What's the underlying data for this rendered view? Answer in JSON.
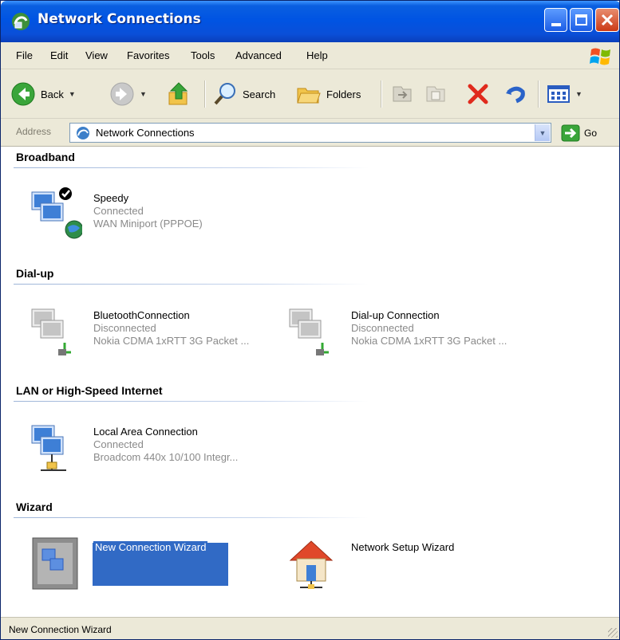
{
  "window": {
    "title": "Network Connections"
  },
  "menu": [
    "File",
    "Edit",
    "View",
    "Favorites",
    "Tools",
    "Advanced",
    "Help"
  ],
  "toolbar": {
    "back_label": "Back",
    "search_label": "Search",
    "folders_label": "Folders"
  },
  "address": {
    "label": "Address",
    "value": "Network Connections",
    "go_label": "Go"
  },
  "groups": {
    "broadband": {
      "title": "Broadband",
      "items": [
        {
          "name": "Speedy",
          "status": "Connected",
          "device": "WAN Miniport (PPPOE)"
        }
      ]
    },
    "dialup": {
      "title": "Dial-up",
      "items": [
        {
          "name": "BluetoothConnection",
          "status": "Disconnected",
          "device": "Nokia CDMA 1xRTT 3G Packet ..."
        },
        {
          "name": "Dial-up Connection",
          "status": "Disconnected",
          "device": "Nokia CDMA 1xRTT 3G Packet ..."
        }
      ]
    },
    "lan": {
      "title": "LAN or High-Speed Internet",
      "items": [
        {
          "name": "Local Area Connection",
          "status": "Connected",
          "device": "Broadcom 440x 10/100 Integr..."
        }
      ]
    },
    "wizard": {
      "title": "Wizard",
      "items": [
        {
          "name": "New Connection Wizard",
          "selected": true
        },
        {
          "name": "Network Setup Wizard"
        }
      ]
    }
  },
  "status_bar": {
    "text": "New Connection Wizard"
  },
  "colors": {
    "titlebar": "#0054e3",
    "selection": "#316ac5",
    "chrome": "#ece9d8",
    "close_button": "#cc3a16"
  },
  "icons": [
    "network-connections-icon",
    "windows-flag-icon",
    "back-icon",
    "forward-icon",
    "up-folder-icon",
    "search-icon",
    "folders-icon",
    "move-to-icon",
    "copy-to-icon",
    "delete-icon",
    "undo-icon",
    "views-icon",
    "go-arrow-icon",
    "broadband-connection-icon",
    "dialup-connection-icon",
    "lan-connection-icon",
    "wizard-icon",
    "house-icon"
  ]
}
